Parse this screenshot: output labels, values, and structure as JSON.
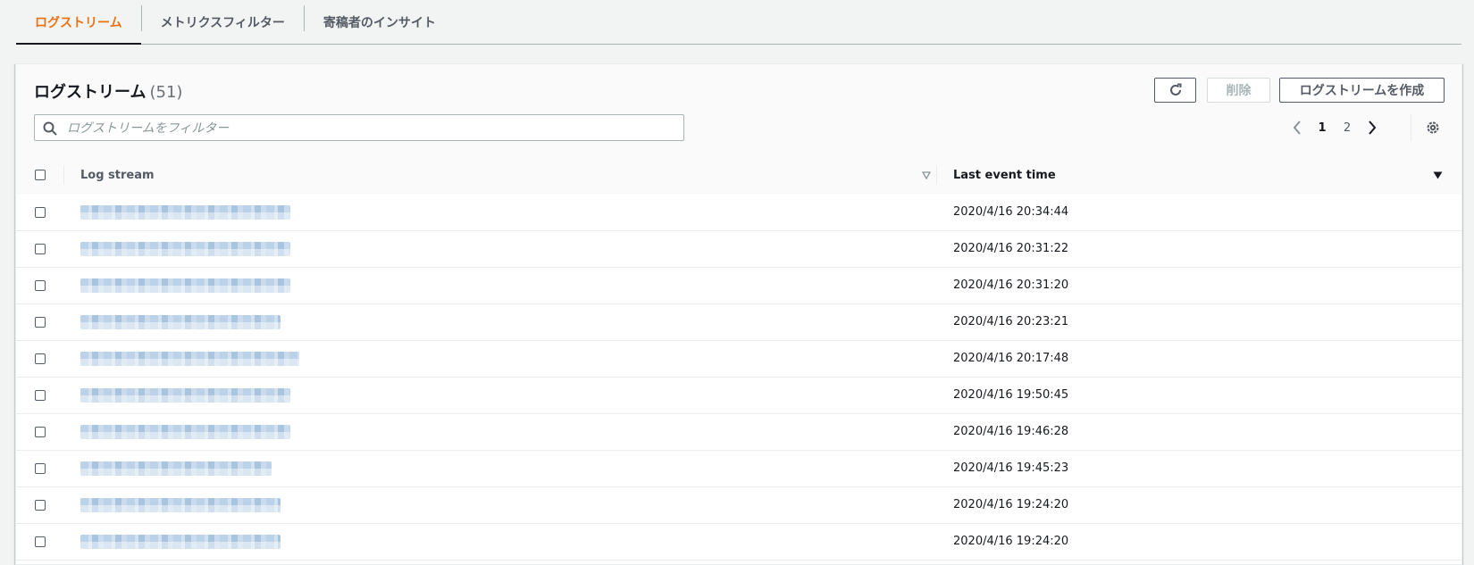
{
  "tabs": [
    {
      "label": "ログストリーム",
      "active": true
    },
    {
      "label": "メトリクスフィルター",
      "active": false
    },
    {
      "label": "寄稿者のインサイト",
      "active": false
    }
  ],
  "panel": {
    "title": "ログストリーム",
    "count": "(51)",
    "buttons": {
      "refresh_icon": "refresh-icon",
      "delete_label": "削除",
      "create_label": "ログストリームを作成"
    },
    "search": {
      "placeholder": "ログストリームをフィルター",
      "value": ""
    },
    "pagination": {
      "current": "1",
      "pages": [
        "1",
        "2"
      ]
    }
  },
  "table": {
    "columns": {
      "log_stream": "Log stream",
      "last_event_time": "Last event time"
    },
    "sort": {
      "column": "last_event_time",
      "direction": "descending"
    },
    "rows": [
      {
        "stream": "",
        "time": "2020/4/16 20:34:44"
      },
      {
        "stream": "",
        "time": "2020/4/16 20:31:22"
      },
      {
        "stream": "",
        "time": "2020/4/16 20:31:20"
      },
      {
        "stream": "",
        "time": "2020/4/16 20:23:21"
      },
      {
        "stream": "",
        "time": "2020/4/16 20:17:48"
      },
      {
        "stream": "",
        "time": "2020/4/16 19:50:45"
      },
      {
        "stream": "",
        "time": "2020/4/16 19:46:28"
      },
      {
        "stream": "",
        "time": "2020/4/16 19:45:23"
      },
      {
        "stream": "",
        "time": "2020/4/16 19:24:20"
      },
      {
        "stream": "",
        "time": "2020/4/16 19:24:20"
      }
    ]
  },
  "colors": {
    "accent": "#ec7211",
    "link": "#0073bb",
    "text": "#16191f",
    "muted": "#545b64"
  }
}
